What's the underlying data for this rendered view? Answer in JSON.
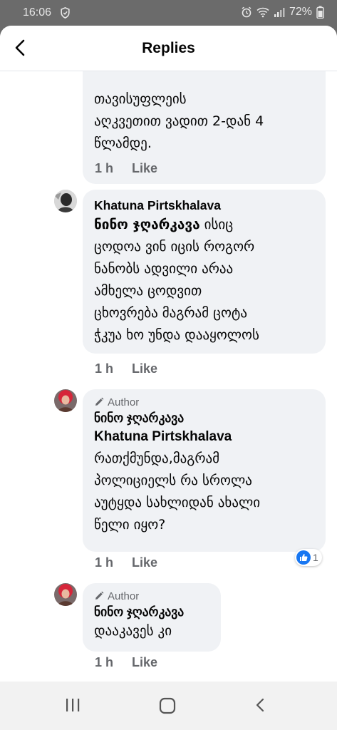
{
  "status_bar": {
    "time": "16:06",
    "battery": "72%"
  },
  "header": {
    "title": "Replies"
  },
  "comments": [
    {
      "text_lines": [
        "თავისუფლეის",
        "აღკვეთით ვადით 2-დან 4",
        "წლამდე."
      ],
      "time": "1 h",
      "like_label": "Like"
    },
    {
      "author": "Khatuna Pirtskhalava",
      "mention": "ნინო ჯღარკავა",
      "text_first": " ისიც",
      "text_lines": [
        "ცოდოა ვინ იცის როგორ",
        "ნანობს ადვილი არაა",
        "ამხელა ცოდვით",
        "ცხოვრება მაგრამ ცოტა",
        "ჭკუა ხო უნდა დააყოლოს"
      ],
      "time": "1 h",
      "like_label": "Like"
    },
    {
      "badge": "Author",
      "author": "ნინო ჯღარკავა",
      "mention": "Khatuna Pirtskhalava",
      "text_lines": [
        "რათქმუნდა,მაგრამ",
        "პოლიციელს რა სროლა",
        "აუტყდა სახლიდან ახალი",
        "წელი იყო?"
      ],
      "time": "1 h",
      "like_label": "Like",
      "reaction_count": "1"
    },
    {
      "badge": "Author",
      "author": "ნინო ჯღარკავა",
      "text_lines": [
        "დააკავეს კი"
      ],
      "time": "1 h",
      "like_label": "Like"
    }
  ],
  "colors": {
    "bubble": "#f0f2f5",
    "meta": "#65676b",
    "like_blue": "#1877f2"
  },
  "icons": [
    "back-arrow-icon",
    "shield-icon",
    "alarm-icon",
    "wifi-icon",
    "signal-icon",
    "battery-icon",
    "pencil-icon",
    "like-icon",
    "recent-apps-icon",
    "home-icon",
    "nav-back-icon"
  ]
}
